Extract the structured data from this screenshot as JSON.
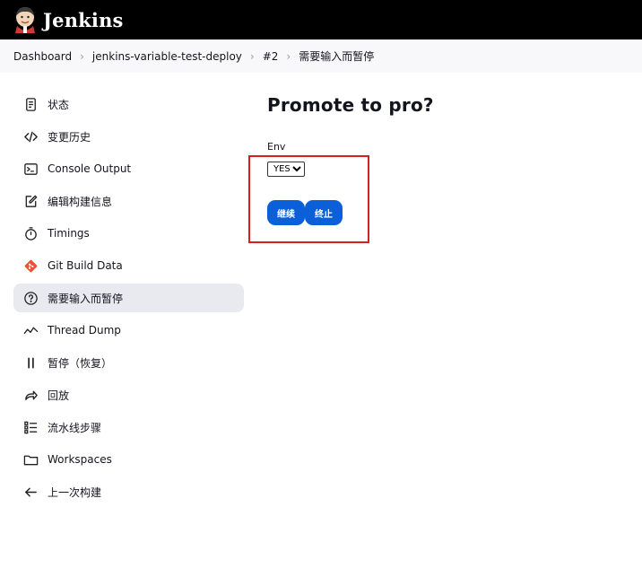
{
  "header": {
    "title": "Jenkins"
  },
  "breadcrumb": [
    "Dashboard",
    "jenkins-variable-test-deploy",
    "#2",
    "需要输入而暂停"
  ],
  "sidebar": {
    "items": [
      {
        "label": "状态",
        "icon": "status-icon"
      },
      {
        "label": "变更历史",
        "icon": "code-icon"
      },
      {
        "label": "Console Output",
        "icon": "terminal-icon"
      },
      {
        "label": "编辑构建信息",
        "icon": "edit-icon"
      },
      {
        "label": "Timings",
        "icon": "stopwatch-icon"
      },
      {
        "label": "Git Build Data",
        "icon": "git-icon"
      },
      {
        "label": "需要输入而暂停",
        "icon": "help-icon",
        "active": true
      },
      {
        "label": "Thread Dump",
        "icon": "pulse-icon"
      },
      {
        "label": "暂停（恢复）",
        "icon": "pause-icon"
      },
      {
        "label": "回放",
        "icon": "replay-icon"
      },
      {
        "label": "流水线步骤",
        "icon": "steps-icon"
      },
      {
        "label": "Workspaces",
        "icon": "folder-icon"
      },
      {
        "label": "上一次构建",
        "icon": "arrow-left-icon"
      }
    ]
  },
  "main": {
    "title": "Promote to pro?",
    "env_label": "Env",
    "env_selected": "YES",
    "proceed_label": "继续",
    "abort_label": "终止"
  },
  "colors": {
    "header_bg": "#000000",
    "accent": "#0b5fd8",
    "highlight": "#d31f26",
    "git": "#f05033"
  }
}
